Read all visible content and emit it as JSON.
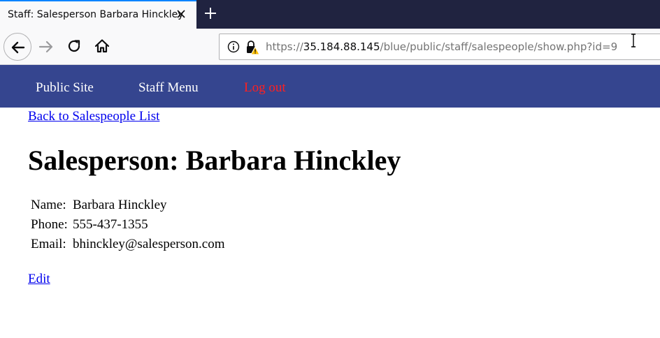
{
  "browser": {
    "tab": {
      "title": "Staff: Salesperson Barbara Hinckley",
      "close_icon": "close-icon"
    },
    "new_tab_icon": "plus-icon",
    "nav_icons": [
      "back-arrow-icon",
      "forward-arrow-icon",
      "reload-icon",
      "home-icon"
    ],
    "url": {
      "scheme": "https://",
      "host": "35.184.88.145",
      "path": "/blue/public/staff/salespeople/show.php?id=9",
      "info_icon": "info-icon",
      "security_icon": "insecure-lock-warning-icon"
    }
  },
  "colors": {
    "site_nav_bg": "#35458f",
    "logout": "#ff2020",
    "link": "#0000ee",
    "tabstrip_bg": "#202340"
  },
  "site_nav": {
    "public_site": "Public Site",
    "staff_menu": "Staff Menu",
    "log_out": "Log out"
  },
  "page": {
    "back_link": "Back to Salespeople List",
    "title": "Salesperson: Barbara Hinckley",
    "details": [
      {
        "label": "Name:",
        "value": "Barbara Hinckley"
      },
      {
        "label": "Phone:",
        "value": "555-437-1355"
      },
      {
        "label": "Email:",
        "value": "bhinckley@salesperson.com"
      }
    ],
    "edit_link": "Edit"
  }
}
